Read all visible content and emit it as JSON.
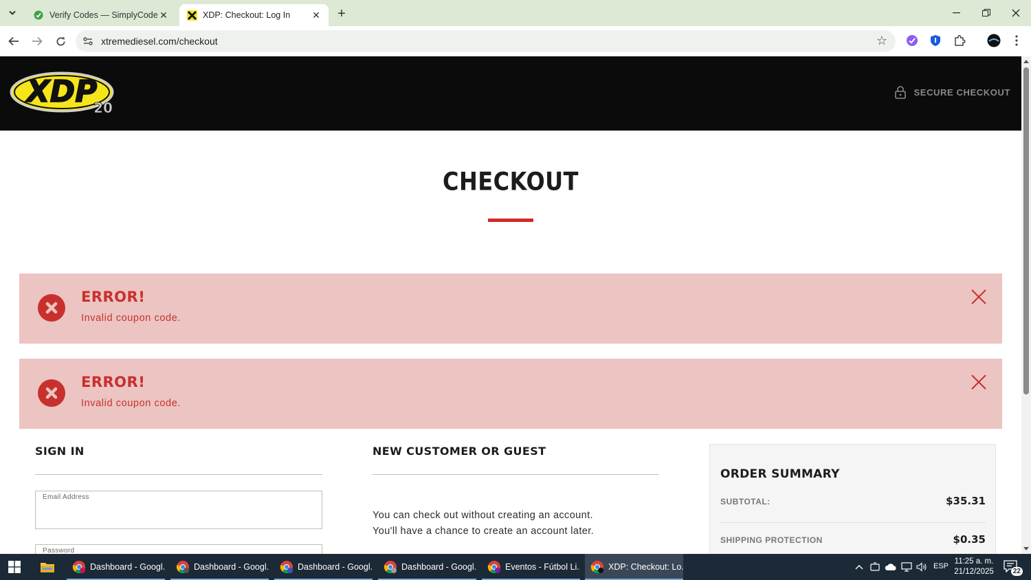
{
  "browser": {
    "tabs": [
      {
        "title": "Verify Codes — SimplyCodes",
        "active": false
      },
      {
        "title": "XDP: Checkout: Log In",
        "active": true
      }
    ],
    "url": "xtremediesel.com/checkout"
  },
  "header": {
    "logo_text": "XDP",
    "logo_badge": "20",
    "secure_label": "SECURE CHECKOUT"
  },
  "page": {
    "title": "CHECKOUT"
  },
  "alerts": [
    {
      "heading": "ERROR!",
      "message": "Invalid coupon code."
    },
    {
      "heading": "ERROR!",
      "message": "Invalid coupon code."
    }
  ],
  "signin": {
    "title": "SIGN IN",
    "email_label": "Email Address",
    "email_value": "",
    "password_label": "Password"
  },
  "guest": {
    "title": "NEW CUSTOMER OR GUEST",
    "line1": "You can check out without creating an account.",
    "line2": "You'll have a chance to create an account later."
  },
  "order_summary": {
    "title": "ORDER SUMMARY",
    "rows": [
      {
        "label": "SUBTOTAL:",
        "value": "$35.31"
      },
      {
        "label": "SHIPPING PROTECTION",
        "value": "$0.35"
      }
    ]
  },
  "taskbar": {
    "items": [
      {
        "label": "Dashboard - Googl...",
        "badge": "S",
        "badge_color": "#c2185b"
      },
      {
        "label": "Dashboard - Googl...",
        "badge": "",
        "badge_color": "#555555"
      },
      {
        "label": "Dashboard - Googl...",
        "badge": "m",
        "badge_color": "#3f51b5"
      },
      {
        "label": "Dashboard - Googl...",
        "badge": "",
        "badge_color": "#9e9e9e"
      },
      {
        "label": "Eventos - Fútbol Li...",
        "badge": "",
        "badge_color": "#7b1fa2"
      },
      {
        "label": "XDP: Checkout: Lo...",
        "badge": "",
        "badge_color": "#111111"
      }
    ],
    "language": "ESP",
    "time": "11:25 a. m.",
    "date": "21/12/2025",
    "notifications": "22"
  },
  "colors": {
    "accent_red": "#d42a2a",
    "alert_bg": "#ecc4c1",
    "alert_text": "#c8302e",
    "header_bg": "#0b0b0b",
    "logo_yellow": "#f5e51b"
  }
}
